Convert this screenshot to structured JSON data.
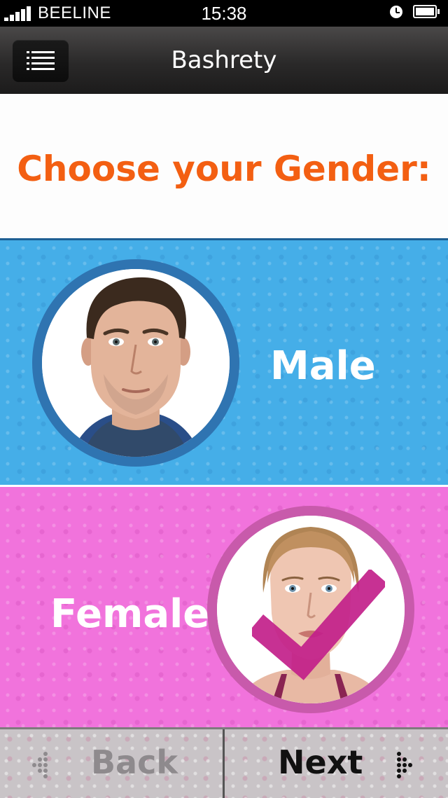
{
  "status_bar": {
    "carrier": "BEELINE",
    "time": "15:38"
  },
  "nav_bar": {
    "title": "Bashrety"
  },
  "page": {
    "title": "Choose your Gender:"
  },
  "options": {
    "male": {
      "label": "Male",
      "selected": false,
      "color": "#45aee8"
    },
    "female": {
      "label": "Female",
      "selected": true,
      "color": "#f173dc"
    }
  },
  "toolbar": {
    "back_label": "Back",
    "next_label": "Next",
    "back_enabled": false
  },
  "colors": {
    "title": "#f35f12",
    "checkmark": "#c2208a"
  }
}
